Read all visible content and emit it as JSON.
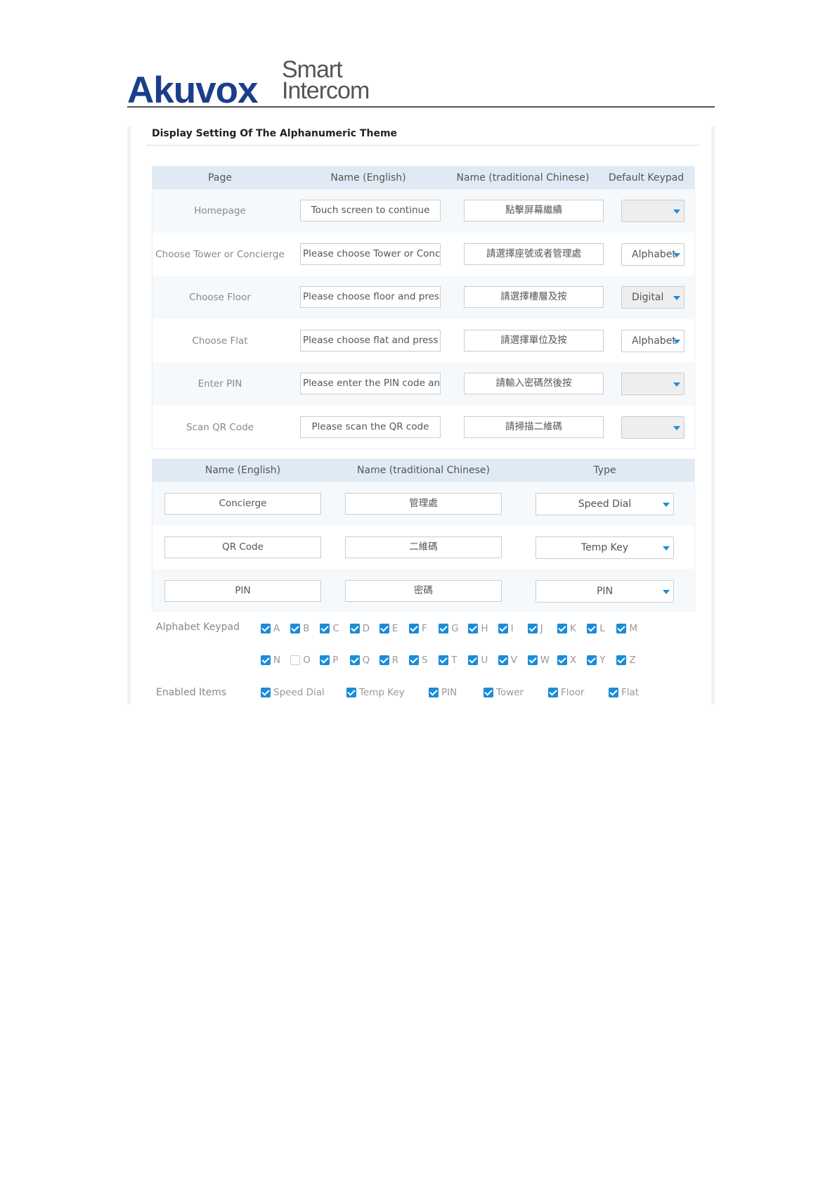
{
  "header": {
    "brand": "Akuvox",
    "tagline_line1": "Smart",
    "tagline_line2": "Intercom",
    "brand_color": "#1b3e8c"
  },
  "panel": {
    "title": "Display Setting Of The Alphanumeric Theme"
  },
  "page_table": {
    "headers": [
      "Page",
      "Name (English)",
      "Name (traditional Chinese)",
      "Default Keypad"
    ],
    "rows": [
      {
        "page": "Homepage",
        "english": "Touch screen to continue",
        "chinese": "點擊屏幕繼續",
        "keypad": "",
        "keypad_enabled": false
      },
      {
        "page": "Choose Tower or Concierge",
        "english": "Please choose Tower or Concie",
        "chinese": "請選擇座號或者管理處",
        "keypad": "Alphabet",
        "keypad_enabled": true
      },
      {
        "page": "Choose Floor",
        "english": "Please choose floor and press",
        "chinese": "請選擇樓層及按",
        "keypad": "Digital",
        "keypad_enabled": false
      },
      {
        "page": "Choose Flat",
        "english": "Please choose flat and press",
        "chinese": "請選擇單位及按",
        "keypad": "Alphabet",
        "keypad_enabled": true
      },
      {
        "page": "Enter PIN",
        "english": "Please enter the PIN code and",
        "chinese": "請輸入密碼然後按",
        "keypad": "",
        "keypad_enabled": false
      },
      {
        "page": "Scan QR Code",
        "english": "Please scan the QR code",
        "chinese": "請掃描二維碼",
        "keypad": "",
        "keypad_enabled": false
      }
    ]
  },
  "item_table": {
    "headers": [
      "Name (English)",
      "Name (traditional Chinese)",
      "Type"
    ],
    "rows": [
      {
        "english": "Concierge",
        "chinese": "管理處",
        "type": "Speed Dial"
      },
      {
        "english": "QR Code",
        "chinese": "二維碼",
        "type": "Temp Key"
      },
      {
        "english": "PIN",
        "chinese": "密碼",
        "type": "PIN"
      }
    ]
  },
  "alphabet_keypad": {
    "label": "Alphabet Keypad",
    "letters": [
      {
        "l": "A",
        "on": true
      },
      {
        "l": "B",
        "on": true
      },
      {
        "l": "C",
        "on": true
      },
      {
        "l": "D",
        "on": true
      },
      {
        "l": "E",
        "on": true
      },
      {
        "l": "F",
        "on": true
      },
      {
        "l": "G",
        "on": true
      },
      {
        "l": "H",
        "on": true
      },
      {
        "l": "I",
        "on": true
      },
      {
        "l": "J",
        "on": true
      },
      {
        "l": "K",
        "on": true
      },
      {
        "l": "L",
        "on": true
      },
      {
        "l": "M",
        "on": true
      },
      {
        "l": "N",
        "on": true
      },
      {
        "l": "O",
        "on": false
      },
      {
        "l": "P",
        "on": true
      },
      {
        "l": "Q",
        "on": true
      },
      {
        "l": "R",
        "on": true
      },
      {
        "l": "S",
        "on": true
      },
      {
        "l": "T",
        "on": true
      },
      {
        "l": "U",
        "on": true
      },
      {
        "l": "V",
        "on": true
      },
      {
        "l": "W",
        "on": true
      },
      {
        "l": "X",
        "on": true
      },
      {
        "l": "Y",
        "on": true
      },
      {
        "l": "Z",
        "on": true
      }
    ]
  },
  "enabled_items": {
    "label": "Enabled Items",
    "items": [
      {
        "label": "Speed Dial",
        "on": true
      },
      {
        "label": "Temp Key",
        "on": true
      },
      {
        "label": "PIN",
        "on": true
      },
      {
        "label": "Tower",
        "on": true
      },
      {
        "label": "Floor",
        "on": true
      },
      {
        "label": "Flat",
        "on": true
      }
    ]
  },
  "colors": {
    "accent": "#1a8cd8",
    "header_bg": "#dfeaf4",
    "row_alt_bg": "#f6f9fc"
  }
}
